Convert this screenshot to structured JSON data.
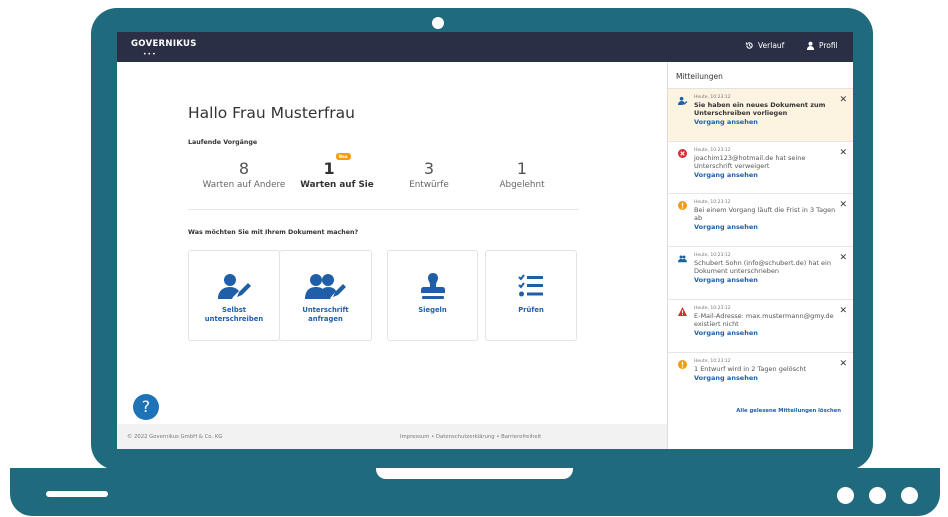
{
  "brand": {
    "logo": "GOVERNIKUS",
    "logo_dots": "•••"
  },
  "nav": {
    "history": "Verlauf",
    "profile": "Profil"
  },
  "greeting": "Hallo Frau Musterfrau",
  "running_title": "Laufende Vorgänge",
  "stats": [
    {
      "count": "8",
      "label": "Warten auf Andere"
    },
    {
      "count": "1",
      "label": "Warten auf Sie",
      "badge": "Neu"
    },
    {
      "count": "3",
      "label": "Entwürfe"
    },
    {
      "count": "1",
      "label": "Abgelehnt"
    }
  ],
  "question": "Was möchten Sie mit Ihrem Dokument machen?",
  "actions": [
    {
      "label_line1": "Selbst",
      "label_line2": "unterschreiben",
      "icon": "user-pen-icon"
    },
    {
      "label_line1": "Unterschrift",
      "label_line2": "anfragen",
      "icon": "users-pen-icon"
    },
    {
      "label_line1": "Siegeln",
      "label_line2": "",
      "icon": "stamp-icon"
    },
    {
      "label_line1": "Prüfen",
      "label_line2": "",
      "icon": "checklist-icon"
    }
  ],
  "help_label": "?",
  "footer": {
    "copyright": "© 2022 Governikus GmbH & Co. KG",
    "links": "Impressum  •  Datenschutzerklärung  •  Barrierefreiheit"
  },
  "notifications": {
    "title": "Mitteilungen",
    "items": [
      {
        "icon": "sign-request-icon",
        "time": "Heute, 10:23:12",
        "text": "Sie haben ein neues Dokument zum Unterschreiben vorliegen",
        "link": "Vorgang ansehen",
        "highlight": true
      },
      {
        "icon": "error-circle-icon",
        "time": "Heute, 10:23:12",
        "text": "joachim123@hotmail.de hat seine Unterschrift verweigert",
        "link": "Vorgang ansehen"
      },
      {
        "icon": "warning-circle-icon",
        "time": "Heute, 10:23:12",
        "text": "Bei einem Vorgang läuft die Frist in 3 Tagen ab",
        "link": "Vorgang ansehen"
      },
      {
        "icon": "users-icon",
        "time": "Heute, 10:23:12",
        "text": "Schubert Sohn (info@schubert.de) hat ein Dokument unterschrieben",
        "link": "Vorgang ansehen"
      },
      {
        "icon": "warning-triangle-icon",
        "time": "Heute, 10:23:12",
        "text": "E-Mail-Adresse: max.mustermann@gmy.de existiert nicht",
        "link": "Vorgang ansehen"
      },
      {
        "icon": "warning-circle-icon",
        "time": "Heute, 10:23:12",
        "text": "1 Entwurf wird in 2 Tagen gelöscht",
        "link": "Vorgang ansehen"
      }
    ],
    "clear_all": "Alle gelesene Mitteilungen löschen"
  },
  "colors": {
    "laptop": "#1f6a7c",
    "topbar": "#2a2f45",
    "link": "#1f5fa8",
    "accent": "#f39c12",
    "error": "#d32f2f"
  }
}
